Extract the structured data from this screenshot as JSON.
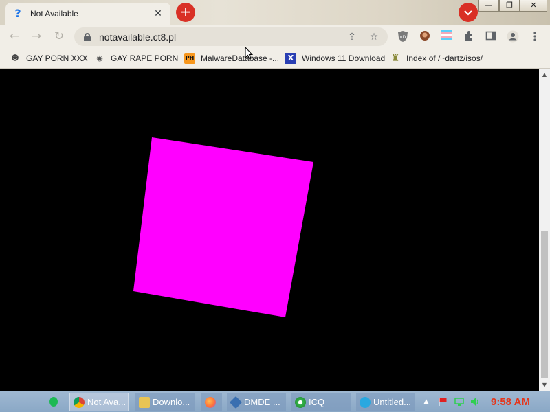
{
  "browser": {
    "tab": {
      "title": "Not Available",
      "favicon": "?",
      "close": "✕"
    },
    "new_tab": "+",
    "tab_search": "⌄",
    "window_buttons": {
      "minimize": "—",
      "restore": "❐",
      "close": "✕"
    }
  },
  "toolbar": {
    "back": "←",
    "forward": "→",
    "reload": "↻",
    "url": "notavailable.ct8.pl",
    "share_icon": "⇪",
    "star_icon": "☆"
  },
  "bookmarks": [
    {
      "label": "GAY PORN XXX",
      "icon": "wolf-icon",
      "glyph": "☻",
      "color": "#444444"
    },
    {
      "label": "GAY RAPE PORN",
      "icon": "globe-icon",
      "glyph": "◉",
      "color": "#555555"
    },
    {
      "label": "MalwareDatabase -...",
      "icon": "ph-icon",
      "glyph": "PH",
      "color": "#f7971d"
    },
    {
      "label": "Windows 11 Download",
      "icon": "x-icon",
      "glyph": "X",
      "color": "#2a3fb3"
    },
    {
      "label": "Index of /~dartz/isos/",
      "icon": "server-icon",
      "glyph": "♜",
      "color": "#8a8a3a"
    }
  ],
  "content": {
    "square_color": "#ff00ff",
    "square_rotation_deg": 10
  },
  "taskbar": {
    "tasks": [
      {
        "label": "Not Ava...",
        "icon": "chrome-icon",
        "color": "#dd4b39",
        "active": true
      },
      {
        "label": "Downlo...",
        "icon": "folder-icon",
        "color": "#e8c454",
        "active": false
      },
      {
        "label": "",
        "icon": "firefox-icon",
        "color": "#ff7139",
        "active": false
      },
      {
        "label": "DMDE ...",
        "icon": "dmde-icon",
        "color": "#3a6fb0",
        "active": false
      },
      {
        "label": "ICQ",
        "icon": "icq-icon",
        "color": "#35b44a",
        "active": false
      },
      {
        "label": "Untitled...",
        "icon": "paint-icon",
        "color": "#29a8e0",
        "active": false
      }
    ],
    "clock": "9:58 AM"
  }
}
